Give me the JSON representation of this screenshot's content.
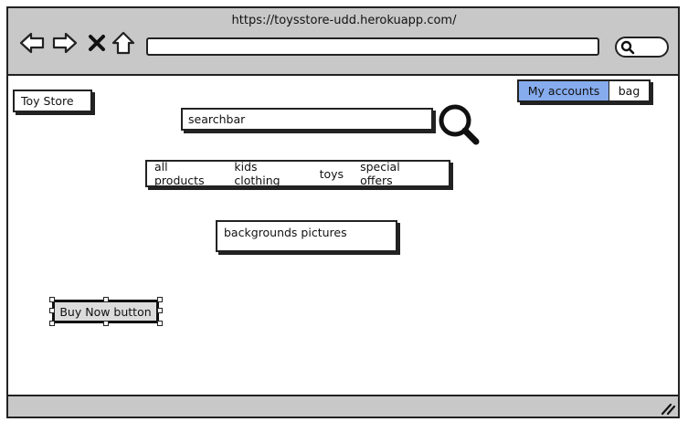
{
  "browser": {
    "url": "https://toysstore-udd.herokuapp.com/",
    "icons": [
      "back-arrow-icon",
      "forward-arrow-icon",
      "close-icon",
      "home-icon",
      "search-icon"
    ]
  },
  "page": {
    "logo": "Toy Store",
    "search_placeholder": "searchbar",
    "account_button": "My accounts",
    "bag_button": "bag",
    "nav_items": [
      "all products",
      "kids clothing",
      "toys",
      "special offers"
    ],
    "background_label": "backgrounds pictures",
    "buy_now": "Buy Now button"
  },
  "colors": {
    "chrome": "#c8c8c8",
    "accent": "#86acee",
    "button_fill": "#dcdcdc"
  }
}
